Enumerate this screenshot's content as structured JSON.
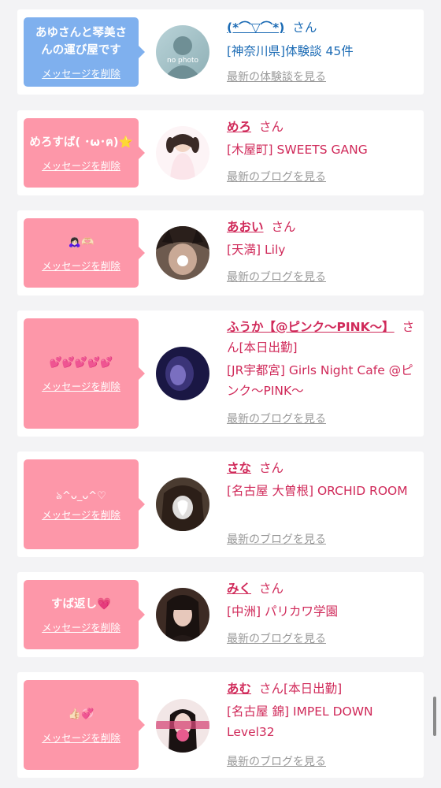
{
  "messages": [
    {
      "message": "あゆさんと琴美さ\nんの運び屋です",
      "delete_label": "メッセージを削除",
      "name": "(*⌒▽⌒*)",
      "suffix": "さん",
      "shop": "[神奈川県]体験談 45件",
      "more": "最新の体験談を見る",
      "avatar_text": "no photo",
      "theme": "blue"
    },
    {
      "message": "めろすば( ･ω･ฅ)⭐",
      "delete_label": "メッセージを削除",
      "name": "めろ",
      "suffix": "さん",
      "shop": "[木屋町] SWEETS GANG",
      "more": "最新のブログを見る",
      "theme": "pink"
    },
    {
      "message": "🙇🏻‍♀️🫶🏻",
      "delete_label": "メッセージを削除",
      "name": "あおい",
      "suffix": "さん",
      "shop": "[天満] Lily",
      "more": "最新のブログを見る",
      "theme": "pink"
    },
    {
      "message": "💕💕💕💕💕",
      "delete_label": "メッセージを削除",
      "name": "ふうか【@ピンク～PINK～】",
      "suffix": "さん[本日出勤]",
      "shop": "[JR宇都宮] Girls Night Cafe @ピンク～PINK～",
      "more": "最新のブログを見る",
      "theme": "pink"
    },
    {
      "message": "ঌ^ᴗ_ᴗ^♡",
      "delete_label": "メッセージを削除",
      "name": "さな",
      "suffix": "さん",
      "shop": "[名古屋 大曽根] ORCHID ROOM",
      "more": "最新のブログを見る",
      "theme": "pink"
    },
    {
      "message": "すば返し💗",
      "delete_label": "メッセージを削除",
      "name": "みく",
      "suffix": "さん",
      "shop": "[中洲] パリカワ学園",
      "more": "最新のブログを見る",
      "theme": "pink"
    },
    {
      "message": "👍🏻💞",
      "delete_label": "メッセージを削除",
      "name": "あむ",
      "suffix": "さん[本日出勤]",
      "shop": "[名古屋 錦] IMPEL DOWN Level32",
      "more": "最新のブログを見る",
      "theme": "pink"
    }
  ],
  "colors": {
    "pink_bubble": "#fd97a9",
    "blue_bubble": "#7fb0ee",
    "pink_text": "#d02a5a",
    "blue_text": "#1a6ab4"
  }
}
